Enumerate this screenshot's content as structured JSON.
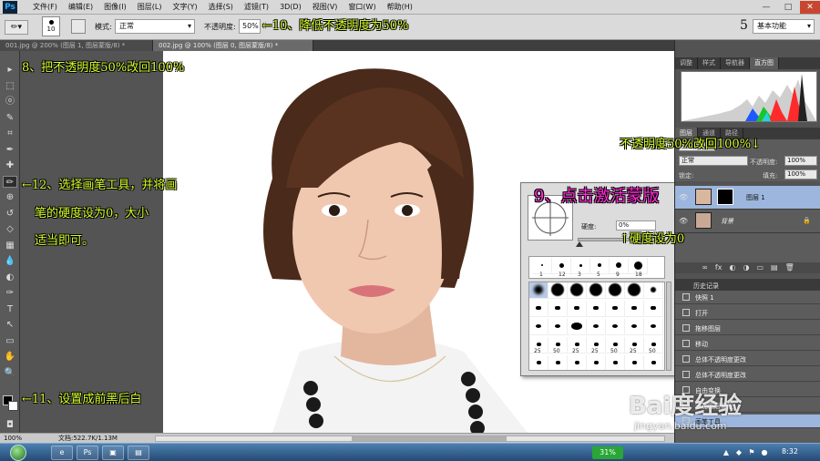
{
  "app": {
    "logo": "Ps"
  },
  "menu": [
    "文件(F)",
    "编辑(E)",
    "图像(I)",
    "图层(L)",
    "文字(Y)",
    "选择(S)",
    "滤镜(T)",
    "3D(D)",
    "视图(V)",
    "窗口(W)",
    "帮助(H)"
  ],
  "window_buttons": {
    "min": "—",
    "max": "□",
    "close": "✕"
  },
  "options": {
    "brush_size": "10",
    "mode_label": "模式:",
    "mode_value": "正常",
    "opacity_label": "不透明度:",
    "opacity_value": "50%",
    "workspace_number": "5",
    "workspace_value": "基本功能"
  },
  "tabs": [
    "001.jpg @ 200% (图层 1, 图层蒙版/8) *",
    "002.jpg @ 100% (图层 0, 图层蒙版/8) *"
  ],
  "tools": [
    "move",
    "marquee",
    "lasso",
    "quick-select",
    "crop",
    "eyedropper",
    "healing",
    "brush",
    "clone",
    "history-brush",
    "eraser",
    "gradient",
    "blur",
    "dodge",
    "pen",
    "type",
    "path-select",
    "shape",
    "hand",
    "zoom"
  ],
  "tool_glyphs": [
    "▸",
    "⬚",
    "ⓞ",
    "✎",
    "⌗",
    "✒",
    "✚",
    "✏",
    "⊕",
    "↺",
    "◇",
    "▦",
    "💧",
    "◐",
    "✑",
    "T",
    "↖",
    "▭",
    "✋",
    "🔍"
  ],
  "status": {
    "zoom": "100%",
    "doc": "文档:522.7K/1.13M"
  },
  "panels": {
    "top_tabs": [
      "调整",
      "样式",
      "导航器",
      "直方图"
    ],
    "top_active": 3,
    "layer_tabs": [
      "图层",
      "通道",
      "路径"
    ],
    "layer_kind": "类型",
    "blend_mode": "正常",
    "opacity_label": "不透明度:",
    "opacity_value": "100%",
    "lock_label": "锁定:",
    "fill_label": "填充:",
    "fill_value": "100%",
    "layers": [
      {
        "name": "图层 1",
        "selected": true
      },
      {
        "name": "背景",
        "selected": false
      }
    ],
    "layer_buttons": [
      "∞",
      "fx",
      "◐",
      "◑",
      "▭",
      "▤",
      "🗑"
    ],
    "history_tab": "历史记录",
    "history": [
      "快照 1",
      "打开",
      "拖移图层",
      "移动",
      "总体不透明度更改",
      "总体不透明度更改",
      "自由变换",
      "添加图层蒙版",
      "画笔工具"
    ]
  },
  "brush_picker": {
    "hardness_label": "硬度:",
    "hardness_value": "0%",
    "top_sizes": [
      "1",
      "12",
      "3",
      "5",
      "9",
      "18"
    ],
    "size_labels": [
      "25",
      "50",
      "25",
      "25",
      "50",
      "25",
      "50"
    ]
  },
  "annotations": {
    "a10": "←10、降低不透明度为50%",
    "a8": "8、把不透明度50%改回100%",
    "a_right_top": "不透明度50%改回100%↓",
    "a12_1": "←12、选择画笔工具，并将画",
    "a12_2": "笔的硬度设为0，大小",
    "a12_3": "适当即可。",
    "a9": "9、点击激活蒙版",
    "a_hard": "↑硬度设为0",
    "a11": "←11、设置成前黑后白"
  },
  "taskbar": {
    "battery": "31%",
    "time": "8:32"
  },
  "watermark": {
    "text": "Bai度经验",
    "url": "jingyan.baidu.com"
  },
  "colors": {
    "annotation_yellow": "#d6ff2a",
    "annotation_magenta": "#ff2bd6",
    "selected_layer": "#9cb6dd"
  }
}
